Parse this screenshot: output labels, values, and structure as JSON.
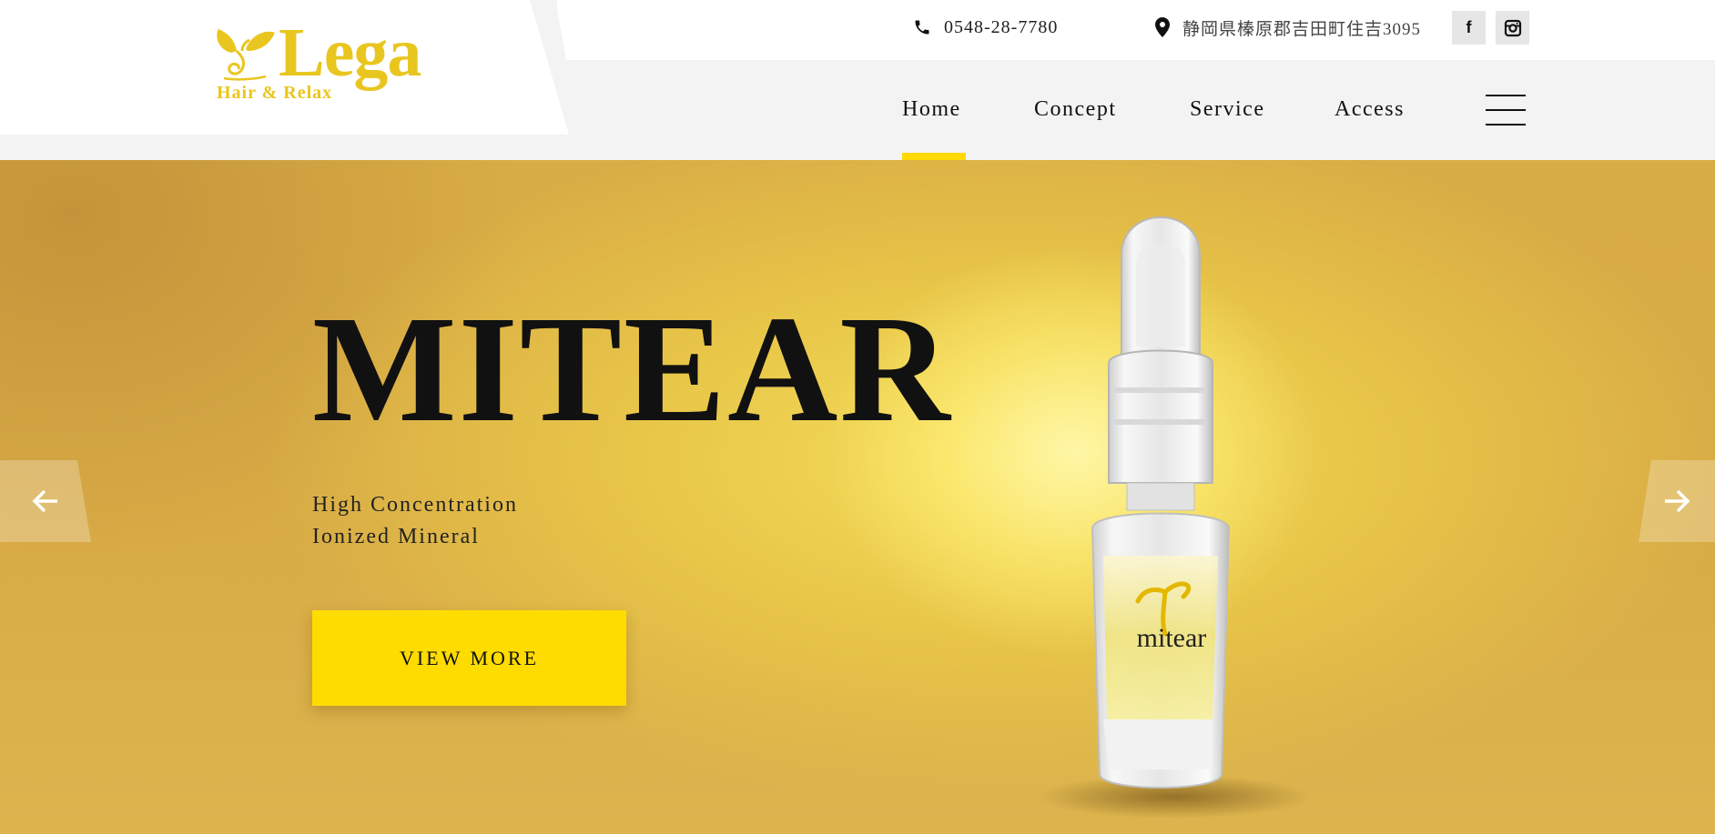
{
  "header": {
    "logo": {
      "word": "Lega",
      "tagline": "Hair & Relax"
    },
    "phone": "0548-28-7780",
    "address": "静岡県榛原郡吉田町住吉3095",
    "social": [
      {
        "name": "facebook",
        "icon": "f"
      },
      {
        "name": "instagram",
        "icon": "instagram-icon"
      }
    ],
    "nav": [
      {
        "label": "Home",
        "active": true
      },
      {
        "label": "Concept",
        "active": false
      },
      {
        "label": "Service",
        "active": false
      },
      {
        "label": "Access",
        "active": false
      }
    ]
  },
  "hero": {
    "title": "MITEAR",
    "subtitle_lines": [
      "High Concentration",
      "Ionized Mineral"
    ],
    "cta_label": "VIEW MORE",
    "product_label": "mitear"
  },
  "colors": {
    "brand_yellow": "#e9c61f",
    "accent": "#ffd900",
    "cta": "#ffdc00",
    "hero_gold": "#d9ad45"
  }
}
